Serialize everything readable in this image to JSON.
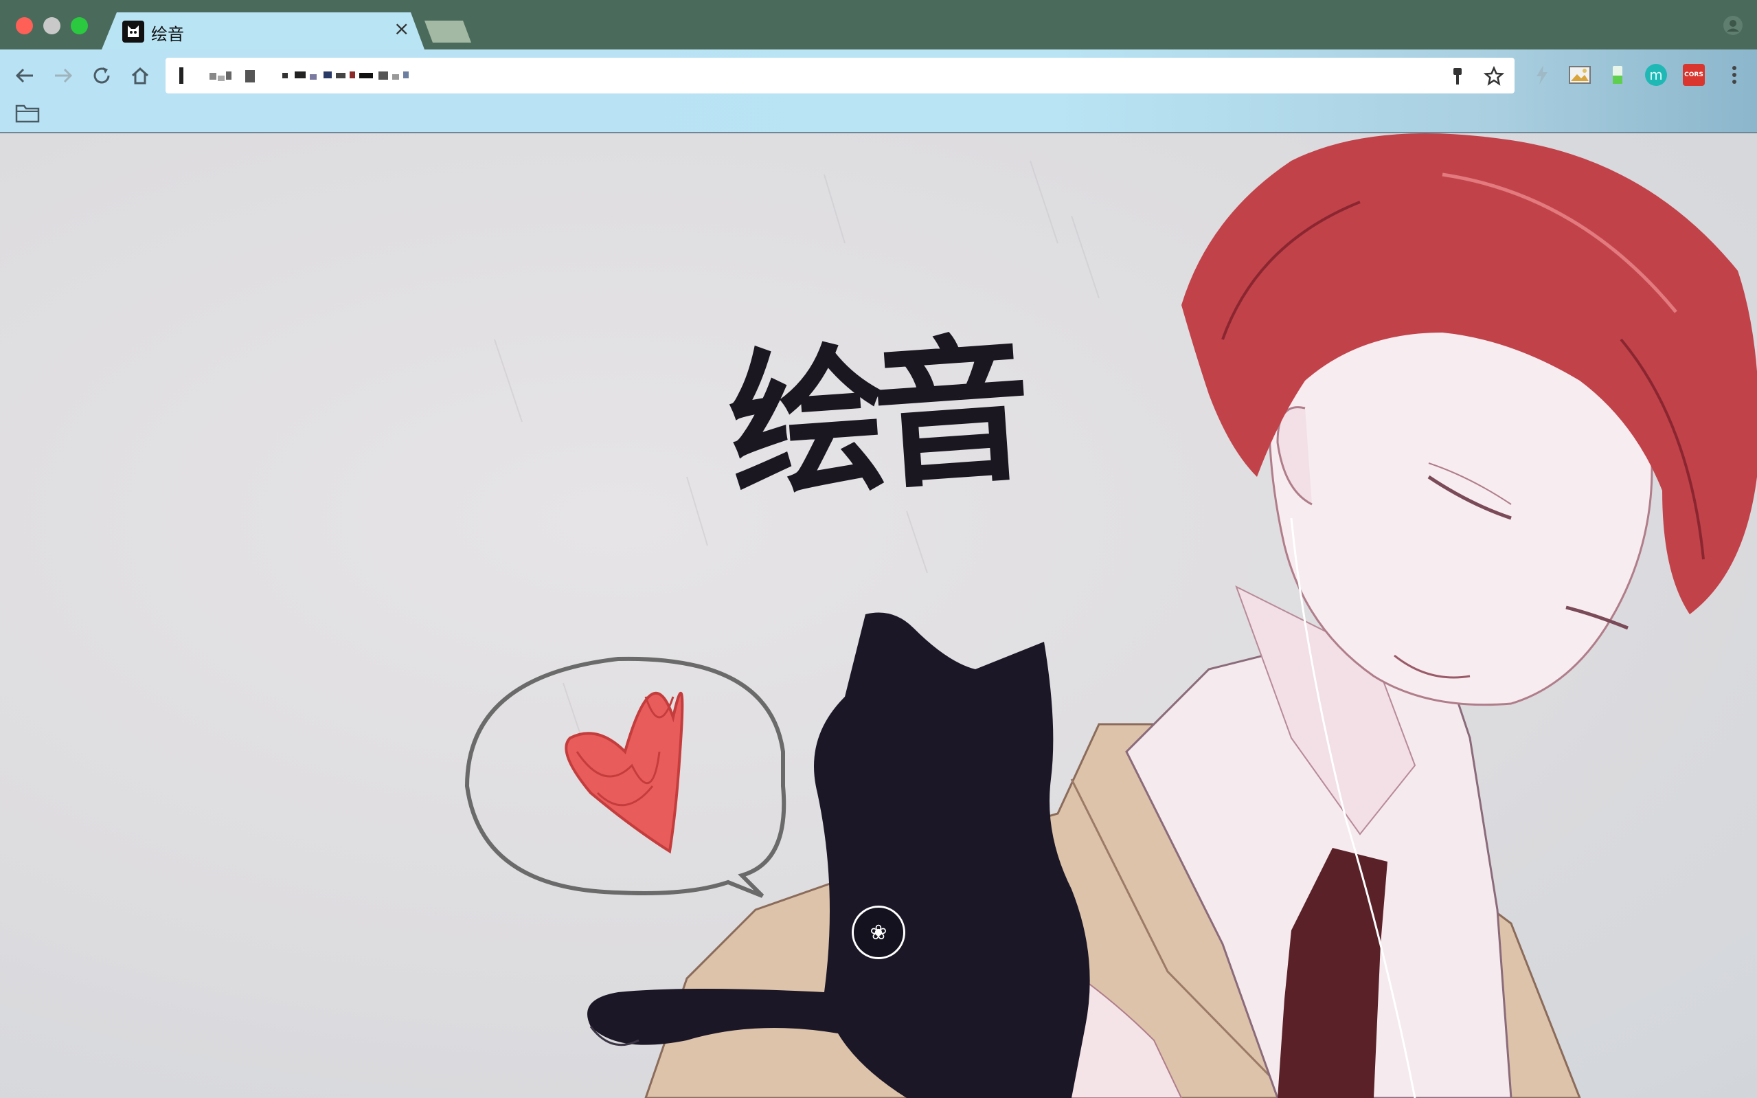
{
  "browser": {
    "tab": {
      "title": "绘音",
      "close_glyph": "×"
    },
    "omnibox": {
      "url": ""
    },
    "extensions": [
      {
        "name": "bolt-extension-icon"
      },
      {
        "name": "image-extension-icon"
      },
      {
        "name": "battery-extension-icon"
      },
      {
        "name": "m-extension-icon",
        "label": "m"
      },
      {
        "name": "cors-extension-icon",
        "label": "CORS"
      }
    ]
  },
  "page": {
    "logo_text": "绘音",
    "center_button_glyph": "❀"
  },
  "colors": {
    "titlebar": "#4a6b5b",
    "toolbar": "#b9e2f4",
    "tab": "#b9e4f4",
    "heart": "#e85c5c",
    "hair": "#c2424a",
    "cat": "#1c1726"
  }
}
